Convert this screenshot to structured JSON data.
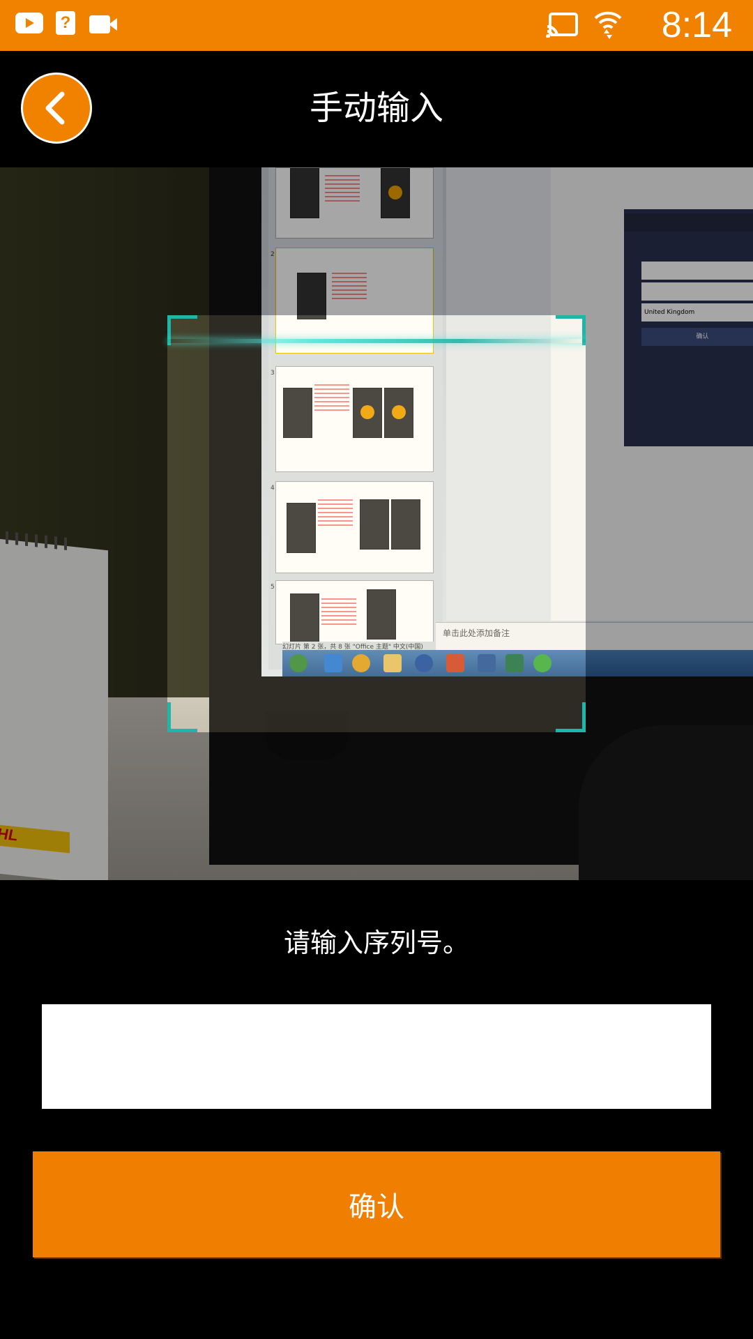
{
  "status_bar": {
    "time": "8:14",
    "left_icons": [
      "youtube-icon",
      "help-icon",
      "video-camera-icon"
    ],
    "right_icons": [
      "cast-icon",
      "wifi-icon"
    ],
    "help_glyph": "?"
  },
  "header": {
    "title": "手动输入",
    "back_icon": "chevron-left-icon"
  },
  "camera_preview": {
    "scan_frame_color": "#1fb5a7",
    "notes_placeholder": "单击此处添加备注",
    "slide_numbers": [
      "2",
      "3",
      "4",
      "5"
    ],
    "statusline_text": "幻灯片 第 2 张，共 8 张   \"Office 主题\"   中文(中国)",
    "phone_shot_field": "United Kingdom",
    "phone_shot_button": "确认",
    "calendar_brand": "DHL"
  },
  "form": {
    "prompt": "请输入序列号。",
    "serial_value": "",
    "serial_placeholder": "",
    "confirm_label": "确认"
  },
  "colors": {
    "accent": "#F08200",
    "background": "#000000",
    "input_background": "#FFFFFF"
  }
}
